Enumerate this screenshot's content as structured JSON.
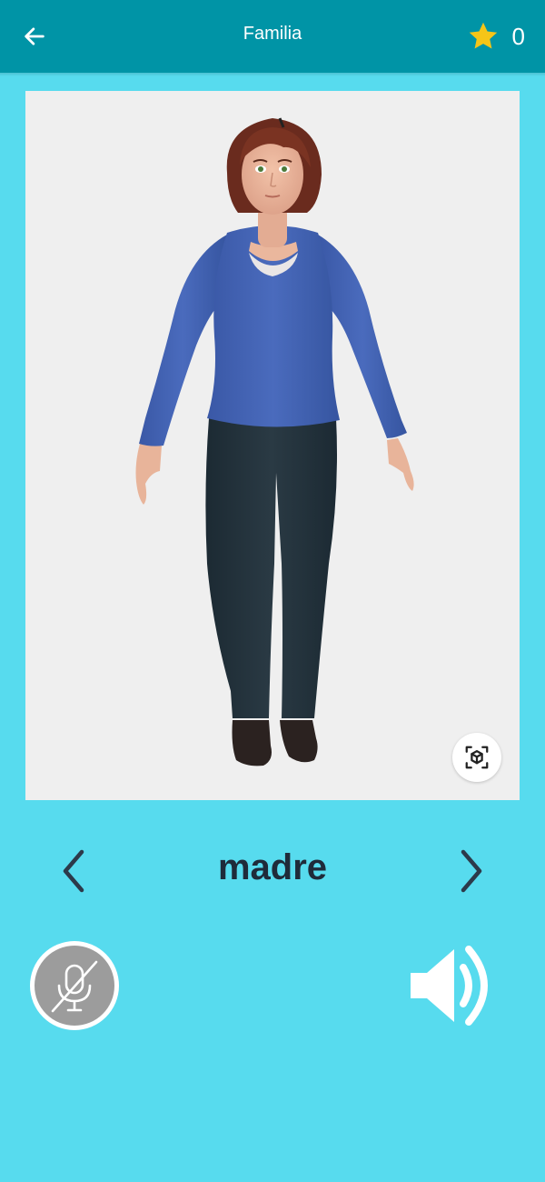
{
  "header": {
    "title": "Familia",
    "score": "0",
    "back_icon": "arrow-left-icon",
    "score_icon": "star-icon",
    "bar_color": "#0094a6"
  },
  "viewer": {
    "ar_icon": "ar-cube-icon",
    "card_color": "#efefef"
  },
  "word_nav": {
    "word": "madre",
    "prev_icon": "chevron-left-icon",
    "next_icon": "chevron-right-icon"
  },
  "controls": {
    "mic_icon": "microphone-off-icon",
    "speaker_icon": "speaker-icon"
  },
  "colors": {
    "background": "#57dbee",
    "star": "#f5c518",
    "word_text": "#1f2b3a"
  }
}
